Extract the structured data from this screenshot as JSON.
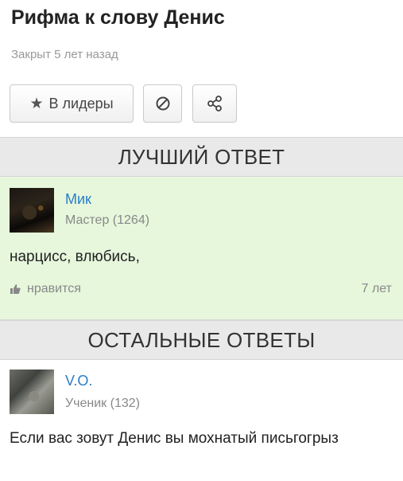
{
  "question": {
    "title": "Рифма к слову Денис",
    "status": "Закрыт 5 лет назад"
  },
  "actions": {
    "leaders_label": "В лидеры"
  },
  "best_section": {
    "heading": "ЛУЧШИЙ ОТВЕТ",
    "answer": {
      "user_name": "Мик",
      "user_rank": "Мастер (1264)",
      "text": "нарцисс, влюбись,",
      "likes_label": "нравится",
      "age": "7 лет"
    }
  },
  "other_section": {
    "heading": "ОСТАЛЬНЫЕ ОТВЕТЫ",
    "answers": [
      {
        "user_name": "V.O.",
        "user_rank": "Ученик (132)",
        "text": "Если вас зовут Денис вы мохнатый письгогрыз"
      }
    ]
  }
}
